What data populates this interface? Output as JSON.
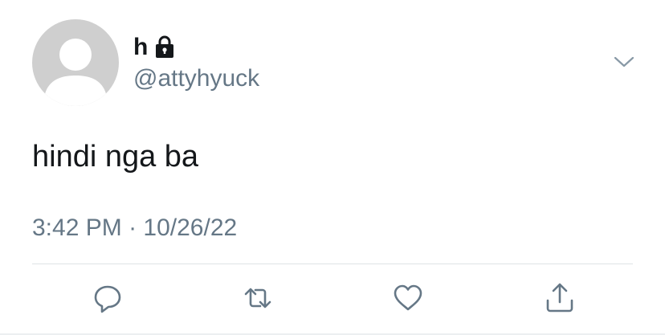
{
  "author": {
    "display_name": "h",
    "handle": "@attyhyuck",
    "protected_icon": "lock-icon",
    "avatar_icon": "default-avatar-silhouette"
  },
  "tweet": {
    "text": "hindi nga ba",
    "time": "3:42 PM",
    "separator": "·",
    "date": "10/26/22"
  },
  "actions": {
    "reply_icon": "reply-icon",
    "retweet_icon": "retweet-icon",
    "like_icon": "heart-icon",
    "share_icon": "share-icon",
    "menu_icon": "chevron-down-icon"
  },
  "colors": {
    "text_primary": "#14171a",
    "text_secondary": "#657786",
    "icon": "#657786",
    "avatar_bg": "#cfcfcf",
    "divider": "#dfe3e6"
  }
}
